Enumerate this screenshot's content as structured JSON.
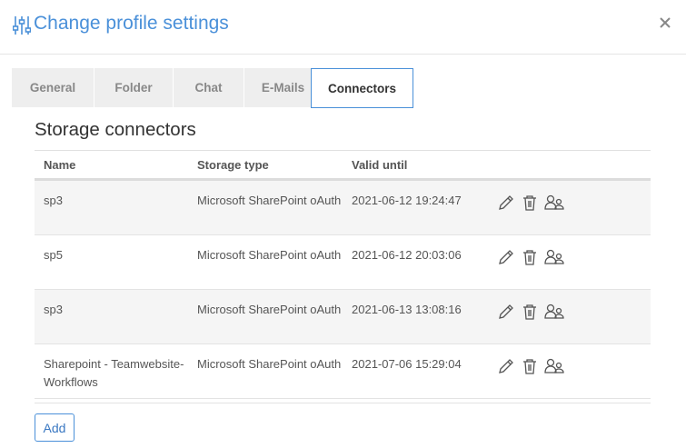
{
  "dialog": {
    "title": "Change profile settings",
    "title_icon": "sliders-icon",
    "close_icon": "close-icon"
  },
  "tabs": [
    {
      "label": "General",
      "active": false
    },
    {
      "label": "Folder",
      "active": false
    },
    {
      "label": "Chat",
      "active": false
    },
    {
      "label": "E-Mails",
      "active": false
    },
    {
      "label": "Connectors",
      "active": true
    }
  ],
  "section": {
    "title": "Storage connectors",
    "columns": [
      "Name",
      "Storage type",
      "Valid until"
    ],
    "rows": [
      {
        "name": "sp3",
        "storage_type": "Microsoft SharePoint oAuth",
        "valid_until": "2021-06-12 19:24:47"
      },
      {
        "name": "sp5",
        "storage_type": "Microsoft SharePoint oAuth",
        "valid_until": "2021-06-12 20:03:06"
      },
      {
        "name": "sp3",
        "storage_type": "Microsoft SharePoint oAuth",
        "valid_until": "2021-06-13 13:08:16"
      },
      {
        "name": "Sharepoint - Teamwebsite-Workflows",
        "storage_type": "Microsoft SharePoint oAuth",
        "valid_until": "2021-07-06 15:29:04"
      }
    ],
    "row_actions": [
      "edit-pencil-icon",
      "delete-trash-icon",
      "share-users-icon"
    ]
  },
  "add_button_label": "Add",
  "colors": {
    "accent": "#4a90d9",
    "tab_bg": "#eeeeee",
    "row_alt_bg": "#f5f5f5",
    "text": "#333333",
    "muted_text": "#888888"
  }
}
